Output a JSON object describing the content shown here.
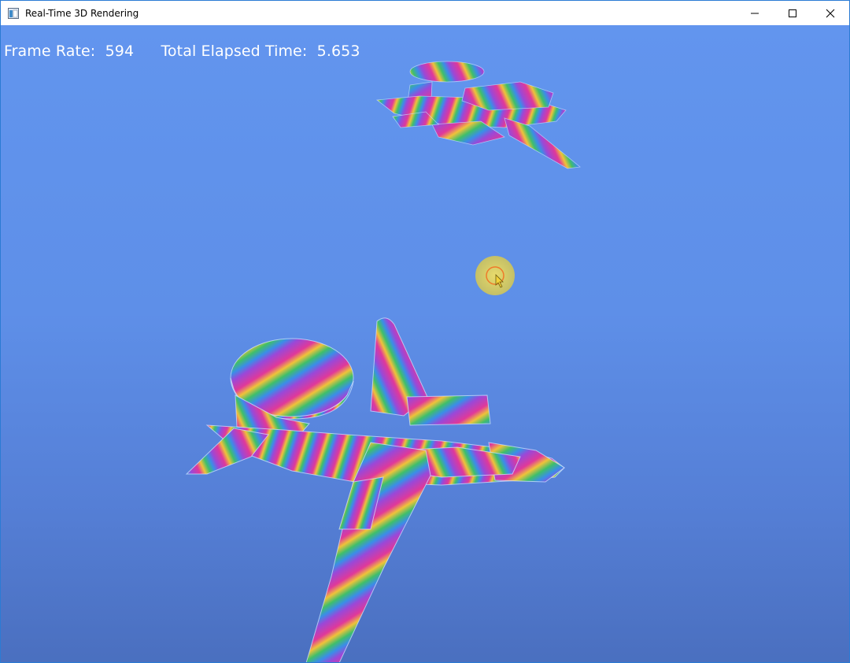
{
  "window": {
    "title": "Real-Time 3D Rendering",
    "icons": {
      "app": "app-window-icon",
      "minimize": "minimize-icon",
      "maximize": "maximize-icon",
      "close": "close-icon"
    }
  },
  "hud": {
    "frame_rate_label": "Frame Rate:",
    "frame_rate_value": "594",
    "elapsed_label": "Total Elapsed Time:",
    "elapsed_value": "5.653"
  },
  "scene": {
    "background_top": "#6295ee",
    "background_bottom": "#4a6fbf",
    "hud_text_color": "#ffffff",
    "cursor_highlight_color": "#e8d55a",
    "cursor_ring_color": "#ef7a2a"
  }
}
